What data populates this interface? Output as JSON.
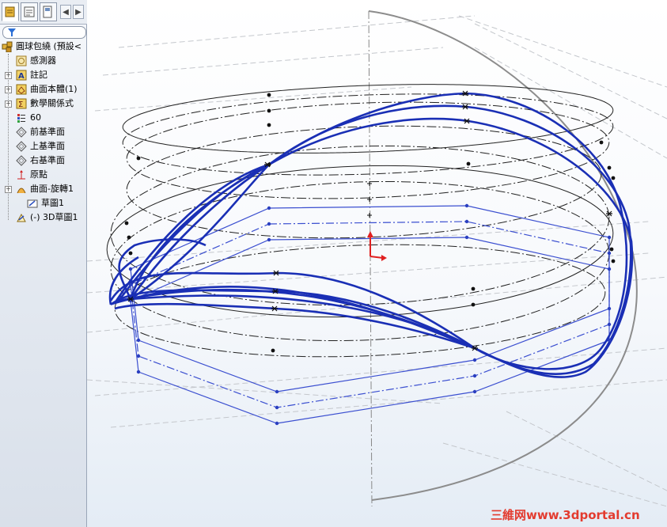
{
  "feature_tree": {
    "root": "圓球包繞 (預設<",
    "items": [
      {
        "label": "感測器",
        "icon": "sensor-icon",
        "expandable": false
      },
      {
        "label": "註記",
        "icon": "annotation-icon",
        "expandable": true
      },
      {
        "label": "曲面本體(1)",
        "icon": "surface-body-icon",
        "expandable": true
      },
      {
        "label": "數學關係式",
        "icon": "equation-icon",
        "expandable": true
      },
      {
        "label": "60",
        "icon": "design-table-icon",
        "expandable": false
      },
      {
        "label": "前基準面",
        "icon": "plane-icon",
        "expandable": false
      },
      {
        "label": "上基準面",
        "icon": "plane-icon",
        "expandable": false
      },
      {
        "label": "右基準面",
        "icon": "plane-icon",
        "expandable": false
      },
      {
        "label": "原點",
        "icon": "origin-icon",
        "expandable": false
      },
      {
        "label": "曲面-旋轉1",
        "icon": "revolve-surface-icon",
        "expandable": true
      },
      {
        "label": "草圖1",
        "icon": "sketch-icon",
        "expandable": false
      },
      {
        "label": "(-) 3D草圖1",
        "icon": "3d-sketch-icon",
        "expandable": false
      }
    ]
  },
  "tabs": [
    "feature-manager-tab",
    "property-manager-tab",
    "configuration-manager-tab"
  ],
  "colors": {
    "curve_blue": "#1a2fb5",
    "sketch_blue": "#3b4fd0",
    "construction": "#222222",
    "axis_red": "#e02020",
    "arc_gray": "#8c8c8c"
  },
  "watermark": "三維网www.3dportal.cn"
}
